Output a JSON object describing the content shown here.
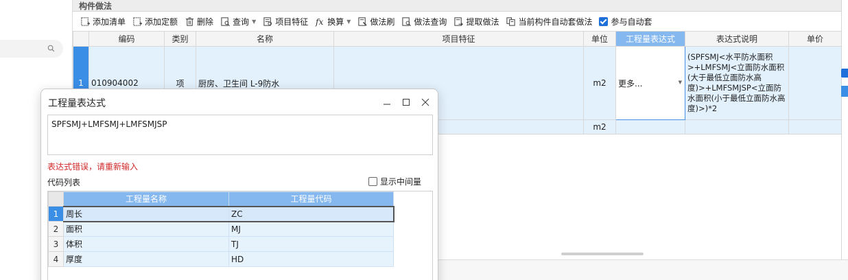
{
  "panel": {
    "title": "构件做法"
  },
  "toolbar": {
    "add_list": "添加清单",
    "add_quota": "添加定额",
    "delete": "删除",
    "query": "查询",
    "item_feature": "项目特征",
    "convert": "换算",
    "method_brush": "做法刷",
    "method_query": "做法查询",
    "extract_method": "提取做法",
    "auto_apply": "当前构件自动套做法",
    "join_auto": "参与自动套"
  },
  "grid": {
    "headers": {
      "code": "编码",
      "category": "类别",
      "name": "名称",
      "feature": "项目特征",
      "unit": "单位",
      "expr": "工程量表达式",
      "expr_desc": "表达式说明",
      "price": "单价"
    },
    "rows": [
      {
        "num": "1",
        "code": "010904002",
        "category": "项",
        "name": "厨房、卫生间 L-9防水",
        "unit": "m2",
        "expr": "更多...",
        "desc": "(SPFSMJ<水平防水面积>+LMFSMJ<立面防水面积(大于最低立面防水高度)>+LMFSMJSP<立面防水面积(小于最低立面防水高度)>)*2"
      },
      {
        "unit": "m2"
      }
    ]
  },
  "dialog": {
    "title": "工程量表达式",
    "expression": "SPFSMJ+LMFSMJ+LMFSMJSP",
    "error": "表达式错误，请重新输入",
    "code_list_label": "代码列表",
    "show_intermediate": "显示中间量",
    "table": {
      "headers": {
        "name": "工程量名称",
        "code": "工程量代码"
      },
      "rows": [
        {
          "num": "1",
          "name": "周长",
          "code": "ZC"
        },
        {
          "num": "2",
          "name": "面积",
          "code": "MJ"
        },
        {
          "num": "3",
          "name": "体积",
          "code": "TJ"
        },
        {
          "num": "4",
          "name": "厚度",
          "code": "HD"
        }
      ]
    }
  },
  "colors": {
    "accent": "#3a8ee6",
    "header_highlight": "#86b8f0",
    "row_bg": "#e3f1fc",
    "error": "#d12a2a"
  },
  "icons": [
    "search-icon",
    "add-list-icon",
    "add-quota-icon",
    "delete-icon",
    "query-icon",
    "feature-icon",
    "fx-icon",
    "brush-icon",
    "method-query-icon",
    "extract-icon",
    "auto-apply-icon",
    "checkbox-checked-icon",
    "minimize-icon",
    "maximize-icon",
    "close-icon"
  ]
}
